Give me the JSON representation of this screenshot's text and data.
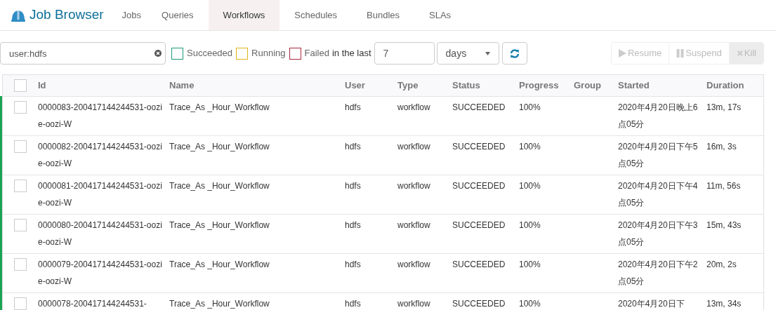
{
  "app": {
    "title": "Job Browser"
  },
  "tabs": [
    {
      "label": "Jobs",
      "selected": false
    },
    {
      "label": "Queries",
      "selected": false
    },
    {
      "label": "Workflows",
      "selected": true
    },
    {
      "label": "Schedules",
      "selected": false
    },
    {
      "label": "Bundles",
      "selected": false
    },
    {
      "label": "SLAs",
      "selected": false
    }
  ],
  "filters": {
    "search": {
      "value": "user:hdfs"
    },
    "statuses": [
      {
        "label": "Succeeded",
        "checked": false,
        "color": "#1e9a7a"
      },
      {
        "label": "Running",
        "checked": false,
        "color": "#e0b31c"
      },
      {
        "label": "Failed",
        "checked": false,
        "color": "#a8283c"
      }
    ],
    "range_label": "in the last",
    "range_value": "7",
    "range_unit": "days"
  },
  "actions": [
    {
      "label": "Resume",
      "disabled": true
    },
    {
      "label": "Suspend",
      "disabled": true
    },
    {
      "label": "Kill",
      "disabled": true
    }
  ],
  "table": {
    "columns": [
      "Id",
      "Name",
      "User",
      "Type",
      "Status",
      "Progress",
      "Group",
      "Started",
      "Duration"
    ],
    "select_all": {
      "checked": false
    },
    "rows": [
      {
        "checked": false,
        "id": "0000083-200417144244531-oozie-oozi-W",
        "name": "Trace_As _Hour_Workflow",
        "user": "hdfs",
        "type": "workflow",
        "status": "SUCCEEDED",
        "progress": "100%",
        "started": "2020年4月20日晚上6点05分",
        "duration": "13m, 17s"
      },
      {
        "checked": false,
        "id": "0000082-200417144244531-oozie-oozi-W",
        "name": "Trace_As _Hour_Workflow",
        "user": "hdfs",
        "type": "workflow",
        "status": "SUCCEEDED",
        "progress": "100%",
        "started": "2020年4月20日下午5点05分",
        "duration": "16m, 3s"
      },
      {
        "checked": false,
        "id": "0000081-200417144244531-oozie-oozi-W",
        "name": "Trace_As _Hour_Workflow",
        "user": "hdfs",
        "type": "workflow",
        "status": "SUCCEEDED",
        "progress": "100%",
        "started": "2020年4月20日下午4点05分",
        "duration": "11m, 56s"
      },
      {
        "checked": false,
        "id": "0000080-200417144244531-oozie-oozi-W",
        "name": "Trace_As _Hour_Workflow",
        "user": "hdfs",
        "type": "workflow",
        "status": "SUCCEEDED",
        "progress": "100%",
        "started": "2020年4月20日下午3点05分",
        "duration": "15m, 43s"
      },
      {
        "checked": false,
        "id": "0000079-200417144244531-oozie-oozi-W",
        "name": "Trace_As _Hour_Workflow",
        "user": "hdfs",
        "type": "workflow",
        "status": "SUCCEEDED",
        "progress": "100%",
        "started": "2020年4月20日下午2点05分",
        "duration": "20m, 2s"
      },
      {
        "checked": false,
        "id": "0000078-200417144244531-",
        "name": "Trace_As _Hour_Workflow",
        "user": "hdfs",
        "type": "workflow",
        "status": "SUCCEEDED",
        "progress": "100%",
        "started": "2020年4月20日下",
        "duration": "13m, 34s"
      }
    ]
  }
}
